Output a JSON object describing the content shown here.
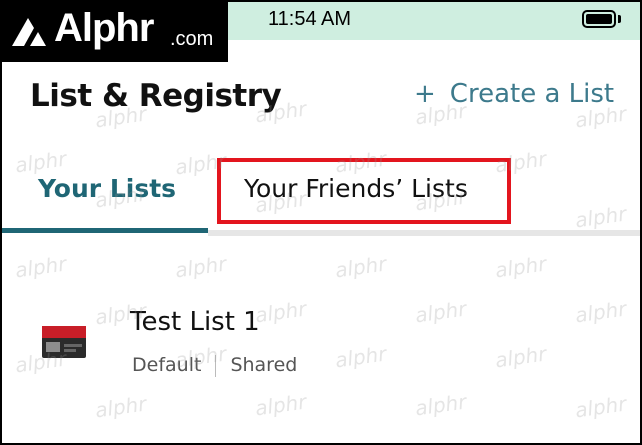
{
  "status_bar": {
    "time": "11:54 AM",
    "battery_icon": "battery-full-icon"
  },
  "logo": {
    "name": "Alphr",
    "suffix": ".com"
  },
  "header": {
    "title": "List & Registry",
    "create_label": "Create a List",
    "create_icon": "+"
  },
  "tabs": [
    {
      "label": "Your Lists",
      "active": true
    },
    {
      "label": "Your Friends’ Lists",
      "active": false
    }
  ],
  "lists": [
    {
      "name": "Test List 1",
      "tags": [
        "Default",
        "Shared"
      ]
    }
  ],
  "watermark": "alphr",
  "colors": {
    "accent": "#1f6675",
    "highlight": "#e3151e",
    "status_bar_bg": "#cfeee0"
  }
}
